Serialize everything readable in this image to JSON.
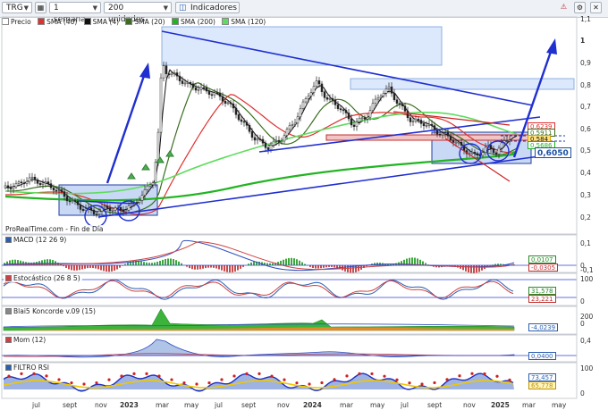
{
  "toolbar": {
    "ticker": "TRG",
    "period": "1 semana",
    "units": "200 unidades",
    "indicators_label": "Indicadores"
  },
  "legend": [
    {
      "label": "Precio",
      "color": "#ffffff"
    },
    {
      "label": "SMA (40)",
      "color": "#e03030"
    },
    {
      "label": "SMA (4)",
      "color": "#111111"
    },
    {
      "label": "SMA (20)",
      "color": "#3a6e1e"
    },
    {
      "label": "SMA (200)",
      "color": "#22b422"
    },
    {
      "label": "SMA (120)",
      "color": "#5fdc5f"
    }
  ],
  "source_label": "ProRealTime.com - Fin de Día",
  "price_tags": [
    {
      "text": "0,6239",
      "color": "#e03030"
    },
    {
      "text": "0,5911",
      "color": "#3a6e1e"
    },
    {
      "text": "0,584",
      "color": "#111111"
    },
    {
      "text": "0,5686",
      "color": "#22b422"
    },
    {
      "text": "0,6050",
      "color": "#1a4fa0"
    }
  ],
  "y_axis_main": [
    "1,1",
    "1",
    "0,9",
    "0,8",
    "0,7",
    "0,6",
    "0,5",
    "0,4",
    "0,3",
    "0,2"
  ],
  "panes": {
    "macd": {
      "title": "MACD (12 26 9)",
      "ticks": [
        "0,1",
        "0",
        "-0,1"
      ],
      "tags": [
        "0,0107",
        "-0,0305"
      ]
    },
    "stoch": {
      "title": "Estocástico (26 8 5)",
      "ticks": [
        "100",
        "0"
      ],
      "tags": [
        "31,578",
        "23,221"
      ]
    },
    "koncorde": {
      "title": "Blai5 Koncorde v.09 (15)",
      "ticks": [
        "200",
        "0"
      ],
      "tags": [
        "-4,0239"
      ]
    },
    "mom": {
      "title": "Mom (12)",
      "ticks": [
        "0,4"
      ],
      "tags": [
        "0,0400"
      ]
    },
    "rsi": {
      "title": "FILTRO RSI",
      "ticks": [
        "100",
        "0"
      ],
      "tags": [
        "73,457",
        "65,778"
      ]
    }
  },
  "x_axis": [
    {
      "label": "jul",
      "bold": false
    },
    {
      "label": "sept",
      "bold": false
    },
    {
      "label": "nov",
      "bold": false
    },
    {
      "label": "2023",
      "bold": true
    },
    {
      "label": "mar",
      "bold": false
    },
    {
      "label": "may",
      "bold": false
    },
    {
      "label": "jul",
      "bold": false
    },
    {
      "label": "sept",
      "bold": false
    },
    {
      "label": "nov",
      "bold": false
    },
    {
      "label": "2024",
      "bold": true
    },
    {
      "label": "mar",
      "bold": false
    },
    {
      "label": "may",
      "bold": false
    },
    {
      "label": "jul",
      "bold": false
    },
    {
      "label": "sept",
      "bold": false
    },
    {
      "label": "nov",
      "bold": false
    },
    {
      "label": "2025",
      "bold": true
    },
    {
      "label": "mar",
      "bold": false
    },
    {
      "label": "may",
      "bold": false
    }
  ]
}
